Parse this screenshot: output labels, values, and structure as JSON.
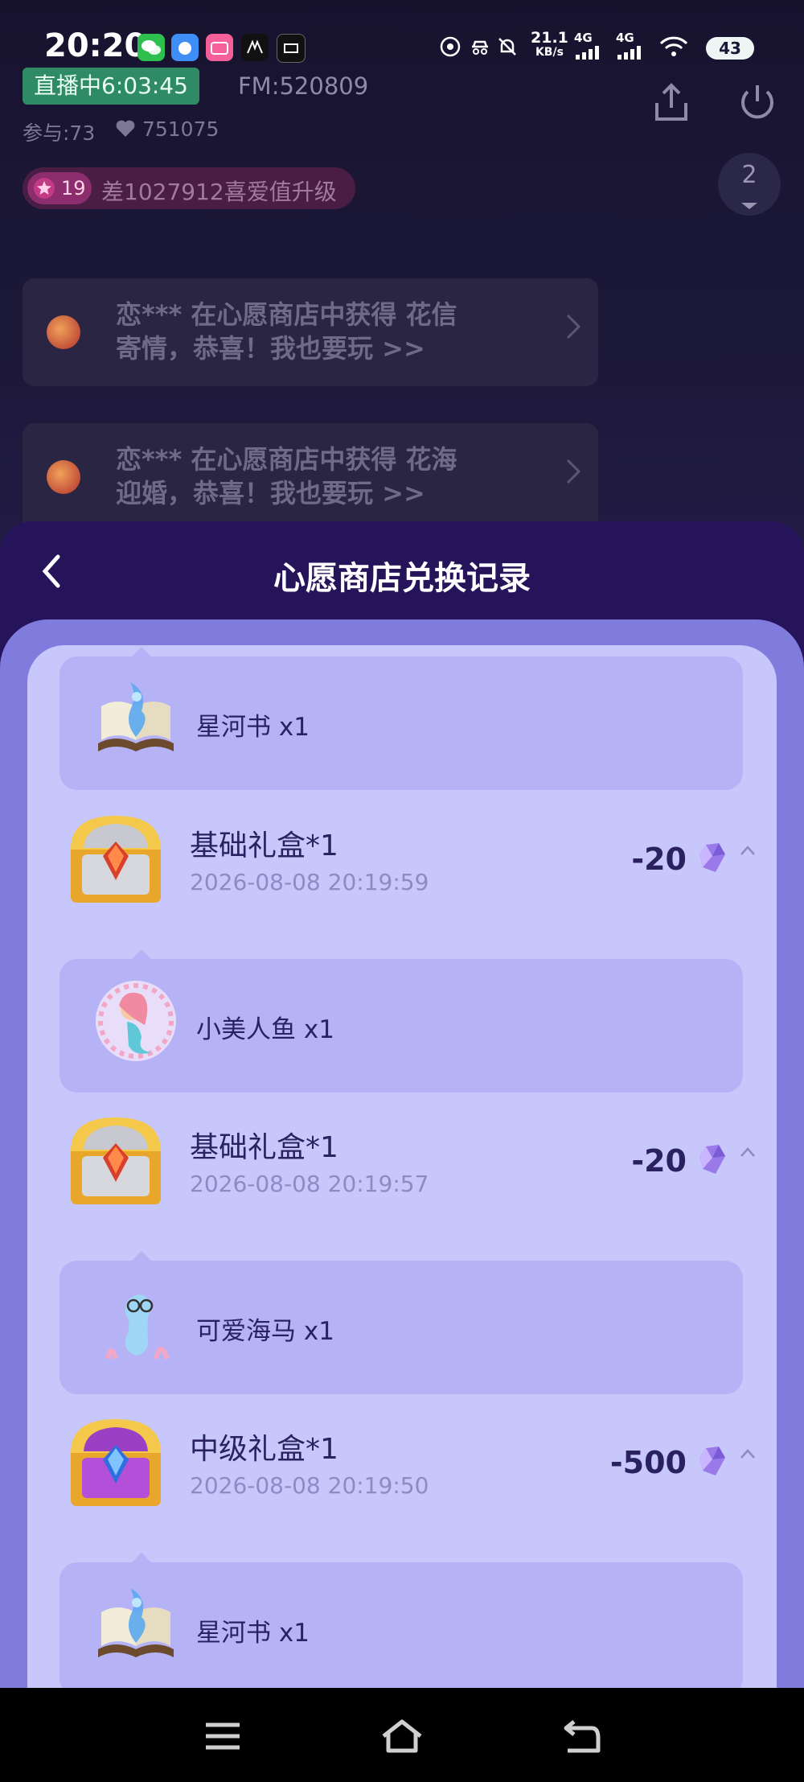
{
  "status_bar": {
    "time": "20:20",
    "speed_value": "21.1",
    "speed_unit": "KB/s",
    "net1": "4G",
    "net2": "4G",
    "battery": "43",
    "apps": [
      "wechat-icon",
      "tieba-icon",
      "bilibili-icon",
      "app-icon",
      "app-icon"
    ]
  },
  "live_header": {
    "live_status": "直播中6:03:45",
    "fm": "FM:520809",
    "participants": "参与:73",
    "likes": "751075",
    "level": "19",
    "level_text": "差1027912喜爱值升级",
    "queue_count": "2"
  },
  "notices": [
    {
      "line1": "恋*** 在心愿商店中获得 花信",
      "line2": "寄情，恭喜！我也要玩 >>"
    },
    {
      "line1": "恋*** 在心愿商店中获得 花海",
      "line2": "迎婚，恭喜！我也要玩 >>"
    }
  ],
  "sheet": {
    "title": "心愿商店兑换记录",
    "records": [
      {
        "reward": "星河书 x1"
      },
      {
        "title": "基础礼盒*1",
        "time": "2026-08-08 20:19:59",
        "cost": "-20",
        "reward": "小美人鱼 x1"
      },
      {
        "title": "基础礼盒*1",
        "time": "2026-08-08 20:19:57",
        "cost": "-20",
        "reward": "可爱海马 x1"
      },
      {
        "title": "中级礼盒*1",
        "time": "2026-08-08 20:19:50",
        "cost": "-500",
        "reward": "星河书 x1"
      }
    ]
  },
  "colors": {
    "sheet_header": "#26145a",
    "outer_panel": "#7f7cde",
    "inner_panel": "#c7c7fb",
    "reward_card": "#b5b3f6",
    "text_dark": "#2a2260",
    "text_muted": "#8d8bc5"
  }
}
